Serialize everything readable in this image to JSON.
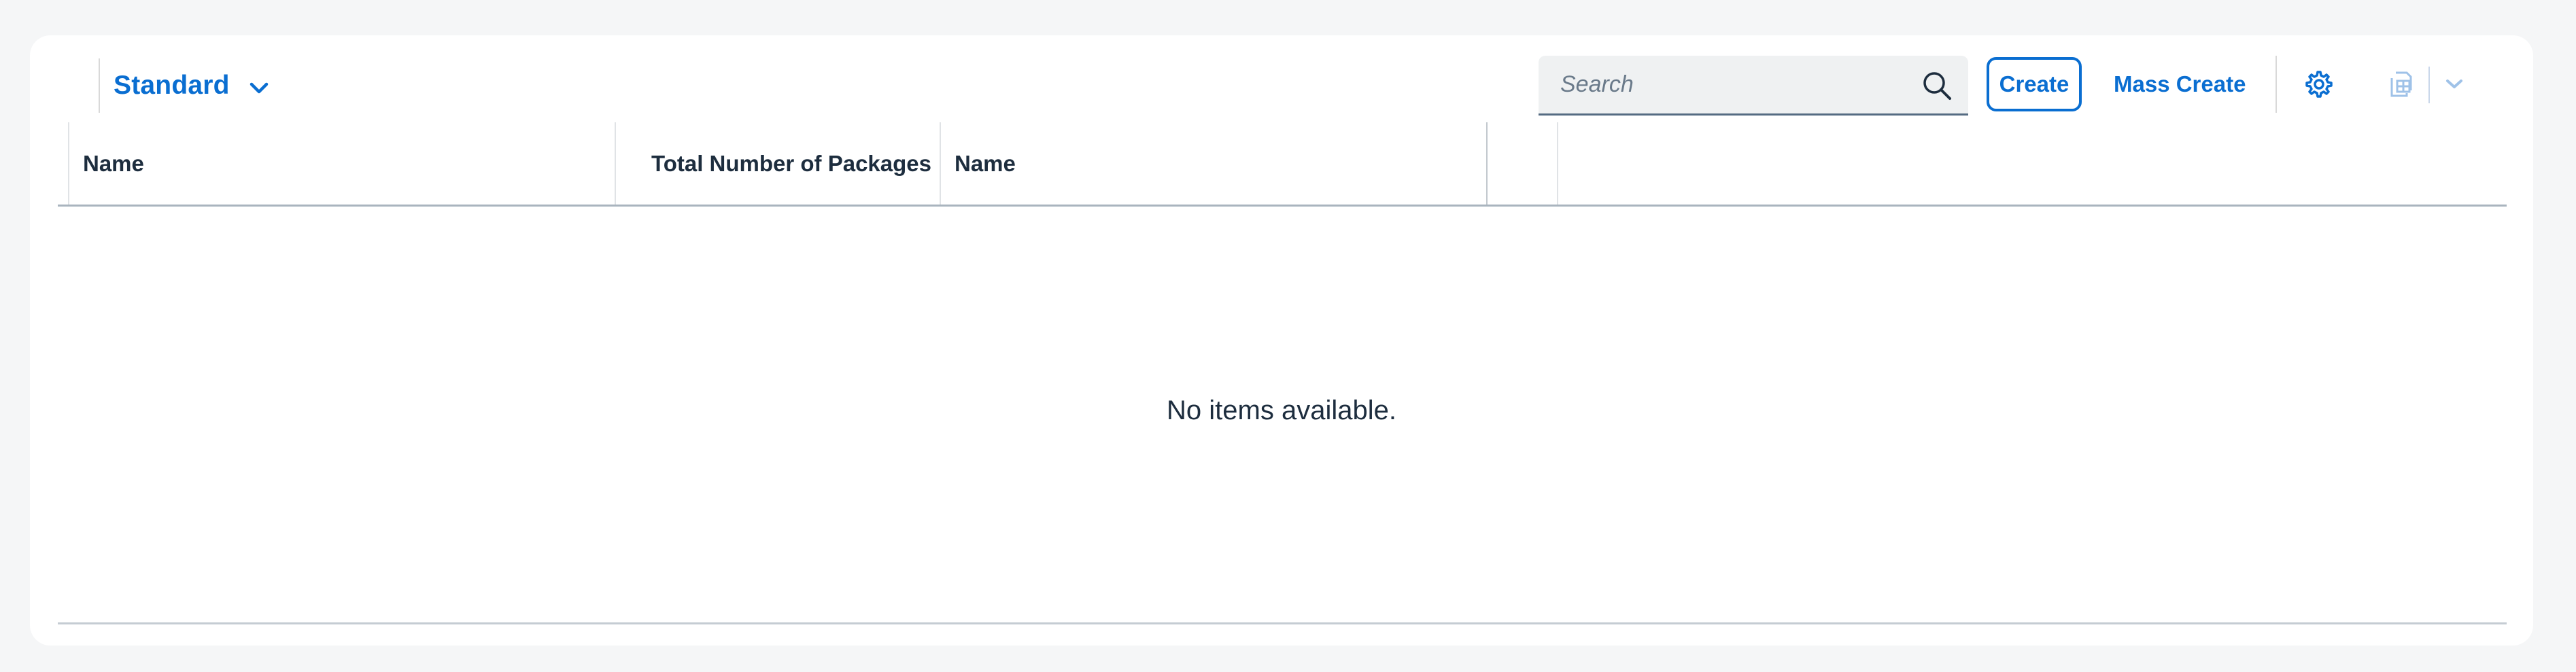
{
  "toolbar": {
    "variant_title": "Standard",
    "search_placeholder": "Search",
    "create_label": "Create",
    "mass_create_label": "Mass Create",
    "icons": {
      "variant": "chevron-down-icon",
      "search": "search-icon",
      "settings": "gear-icon",
      "export": "spreadsheet-export-icon",
      "export_menu": "chevron-down-icon"
    }
  },
  "table": {
    "columns": [
      {
        "label": "Name"
      },
      {
        "label": "Total Number of Packages"
      },
      {
        "label": "Name"
      },
      {
        "label": ""
      }
    ],
    "rows": [],
    "empty_text": "No items available."
  },
  "colors": {
    "accent": "#0a6ed1",
    "background": "#f5f6f7",
    "card": "#ffffff",
    "text": "#1d2d3e"
  }
}
